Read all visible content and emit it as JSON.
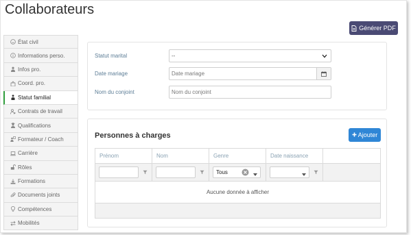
{
  "header": {
    "title": "Collaborateurs",
    "pdf_button_label": "Générer PDF"
  },
  "sidebar": {
    "items": [
      {
        "label": "État civil",
        "icon": "smile-icon",
        "active": false
      },
      {
        "label": "Informations perso.",
        "icon": "info-circle-icon",
        "active": false
      },
      {
        "label": "Infos pro.",
        "icon": "user-tie-icon",
        "active": false
      },
      {
        "label": "Coord. pro.",
        "icon": "building-icon",
        "active": false
      },
      {
        "label": "Statut familial",
        "icon": "family-icon",
        "active": true
      },
      {
        "label": "Contrats de travail",
        "icon": "users-cog-icon",
        "active": false
      },
      {
        "label": "Qualifications",
        "icon": "user-graduate-icon",
        "active": false
      },
      {
        "label": "Formateur / Coach",
        "icon": "teacher-icon",
        "active": false
      },
      {
        "label": "Carrière",
        "icon": "laptop-icon",
        "active": false
      },
      {
        "label": "Rôles",
        "icon": "unlock-icon",
        "active": false
      },
      {
        "label": "Formations",
        "icon": "download-icon",
        "active": false
      },
      {
        "label": "Documents joints",
        "icon": "paperclip-icon",
        "active": false
      },
      {
        "label": "Compétences",
        "icon": "lightbulb-icon",
        "active": false
      },
      {
        "label": "Mobilités",
        "icon": "exchange-icon",
        "active": false
      }
    ]
  },
  "family_form": {
    "statut_marital": {
      "label": "Statut marital",
      "value": "--"
    },
    "date_mariage": {
      "label": "Date mariage",
      "placeholder": "Date mariage"
    },
    "nom_conjoint": {
      "label": "Nom du conjoint",
      "placeholder": "Nom du conjoint"
    }
  },
  "dependents": {
    "title": "Personnes à charges",
    "add_label": "Ajouter",
    "columns": [
      "Prénom",
      "Nom",
      "Genre",
      "Date naissance"
    ],
    "genre_filter_value": "Tous",
    "empty_message": "Aucune donnée à afficher"
  },
  "colors": {
    "pdf_button": "#4a4a74",
    "add_button": "#2f86d6",
    "active_accent": "#2e9c3b",
    "label_text": "#5c7d96"
  }
}
